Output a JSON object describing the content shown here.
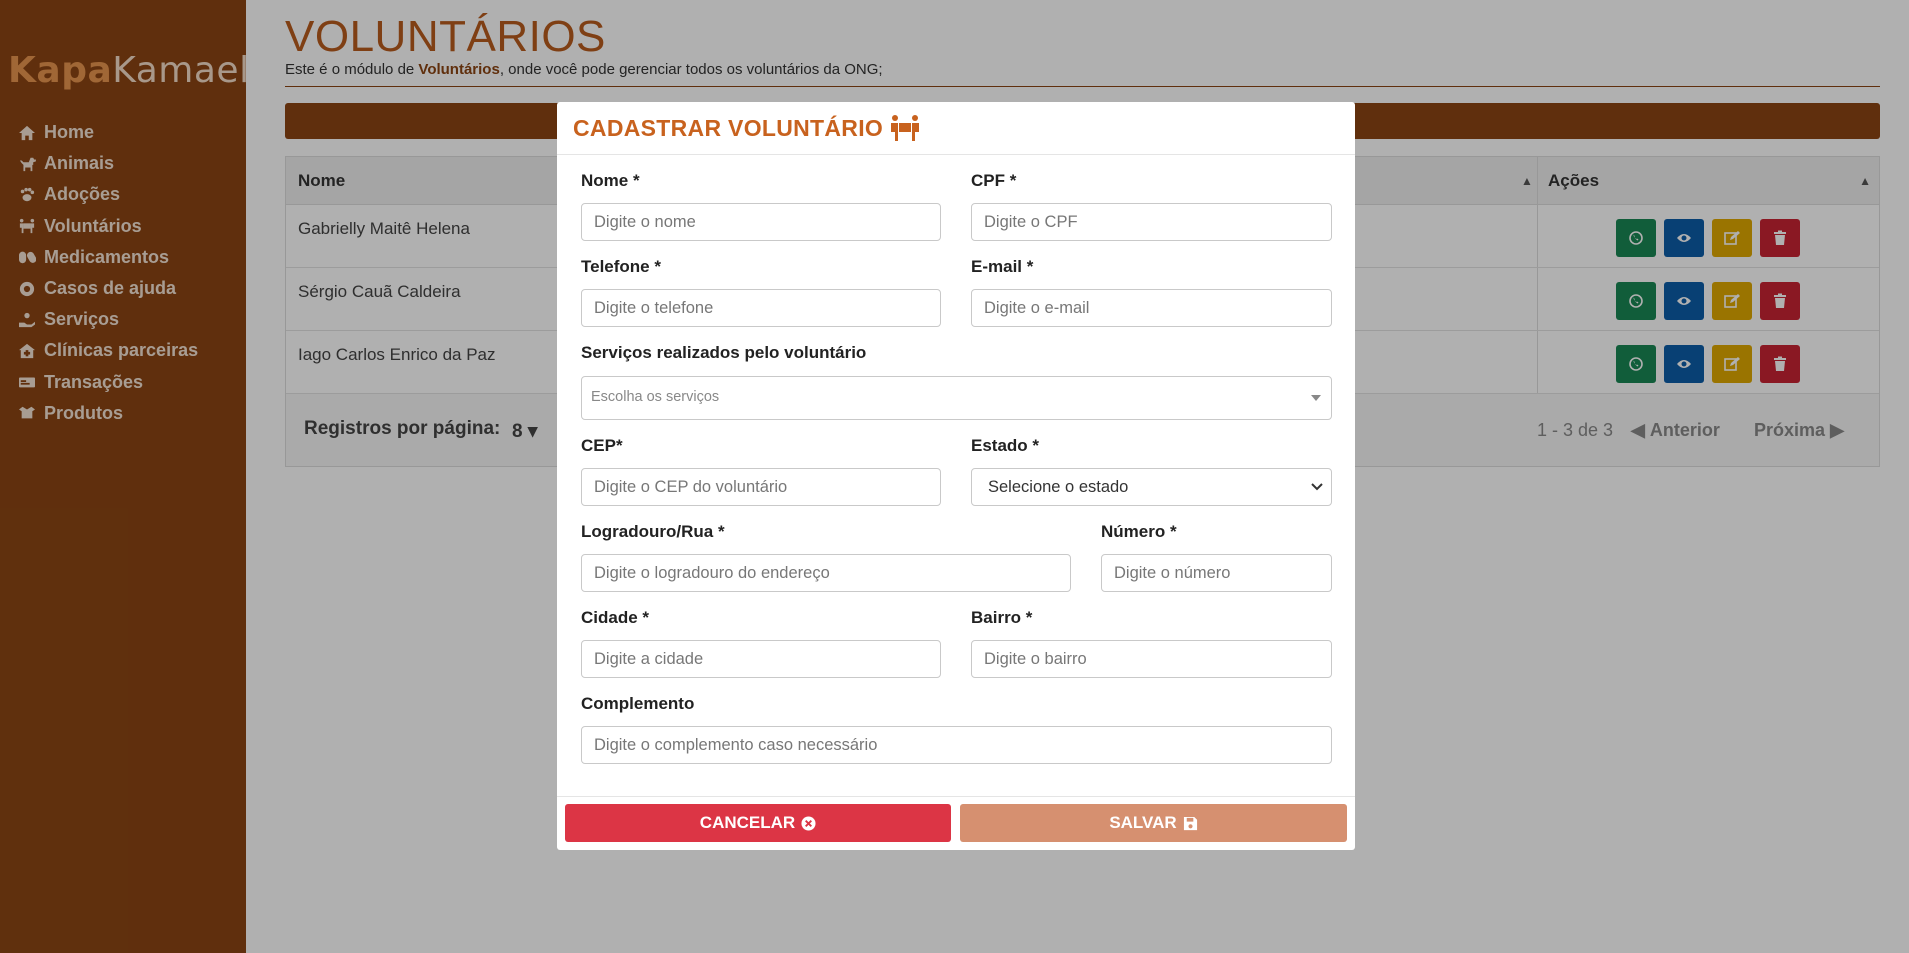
{
  "brand": {
    "part1": "Kapa",
    "part2": "Kamael"
  },
  "sidebar": {
    "items": [
      {
        "label": "Home",
        "icon": "home-icon"
      },
      {
        "label": "Animais",
        "icon": "dog-icon"
      },
      {
        "label": "Adoções",
        "icon": "paw-icon"
      },
      {
        "label": "Voluntários",
        "icon": "people-carry-icon"
      },
      {
        "label": "Medicamentos",
        "icon": "capsules-icon"
      },
      {
        "label": "Casos de ajuda",
        "icon": "life-ring-icon"
      },
      {
        "label": "Serviços",
        "icon": "hand-holding-icon"
      },
      {
        "label": "Clínicas parceiras",
        "icon": "clinic-icon"
      },
      {
        "label": "Transações",
        "icon": "money-bill-icon"
      },
      {
        "label": "Produtos",
        "icon": "box-open-icon"
      }
    ]
  },
  "page": {
    "title": "VOLUNTÁRIOS",
    "desc_prefix": "Este é o módulo de ",
    "desc_bold": "Voluntários",
    "desc_suffix": ", onde você pode gerenciar todos os voluntários da ONG;"
  },
  "table": {
    "col_name": "Nome",
    "col_actions": "Ações",
    "rows": [
      "Gabrielly Maitê Helena",
      "Sérgio Cauã Caldeira",
      "Iago Carlos Enrico da Paz"
    ],
    "footer": {
      "rows_per_page_label": "Registros por página:",
      "rows_per_page_value": "8",
      "range": "1 - 3 de 3",
      "prev": "Anterior",
      "next": "Próxima"
    }
  },
  "modal": {
    "title": "CADASTRAR VOLUNTÁRIO",
    "fields": {
      "nome": {
        "label": "Nome *",
        "placeholder": "Digite o nome"
      },
      "cpf": {
        "label": "CPF *",
        "placeholder": "Digite o CPF"
      },
      "telefone": {
        "label": "Telefone *",
        "placeholder": "Digite o telefone"
      },
      "email": {
        "label": "E-mail *",
        "placeholder": "Digite o e-mail"
      },
      "servicos": {
        "label": "Serviços realizados pelo voluntário",
        "placeholder": "Escolha os serviços"
      },
      "cep": {
        "label": "CEP*",
        "placeholder": "Digite o CEP do voluntário"
      },
      "estado": {
        "label": "Estado *",
        "value": "Selecione o estado"
      },
      "logradouro": {
        "label": "Logradouro/Rua *",
        "placeholder": "Digite o logradouro do endereço"
      },
      "numero": {
        "label": "Número *",
        "placeholder": "Digite o número"
      },
      "cidade": {
        "label": "Cidade *",
        "placeholder": "Digite a cidade"
      },
      "bairro": {
        "label": "Bairro *",
        "placeholder": "Digite o bairro"
      },
      "complemento": {
        "label": "Complemento",
        "placeholder": "Digite o complemento caso necessário"
      }
    },
    "cancel_label": "CANCELAR",
    "save_label": "SALVAR"
  },
  "colors": {
    "sidebar": "#8b4513",
    "accent": "#c8621e",
    "cancel": "#dc3545",
    "save": "#d69070",
    "whatsapp": "#198754",
    "view": "#0d5ea8",
    "edit": "#e0a800",
    "delete": "#c82333"
  }
}
